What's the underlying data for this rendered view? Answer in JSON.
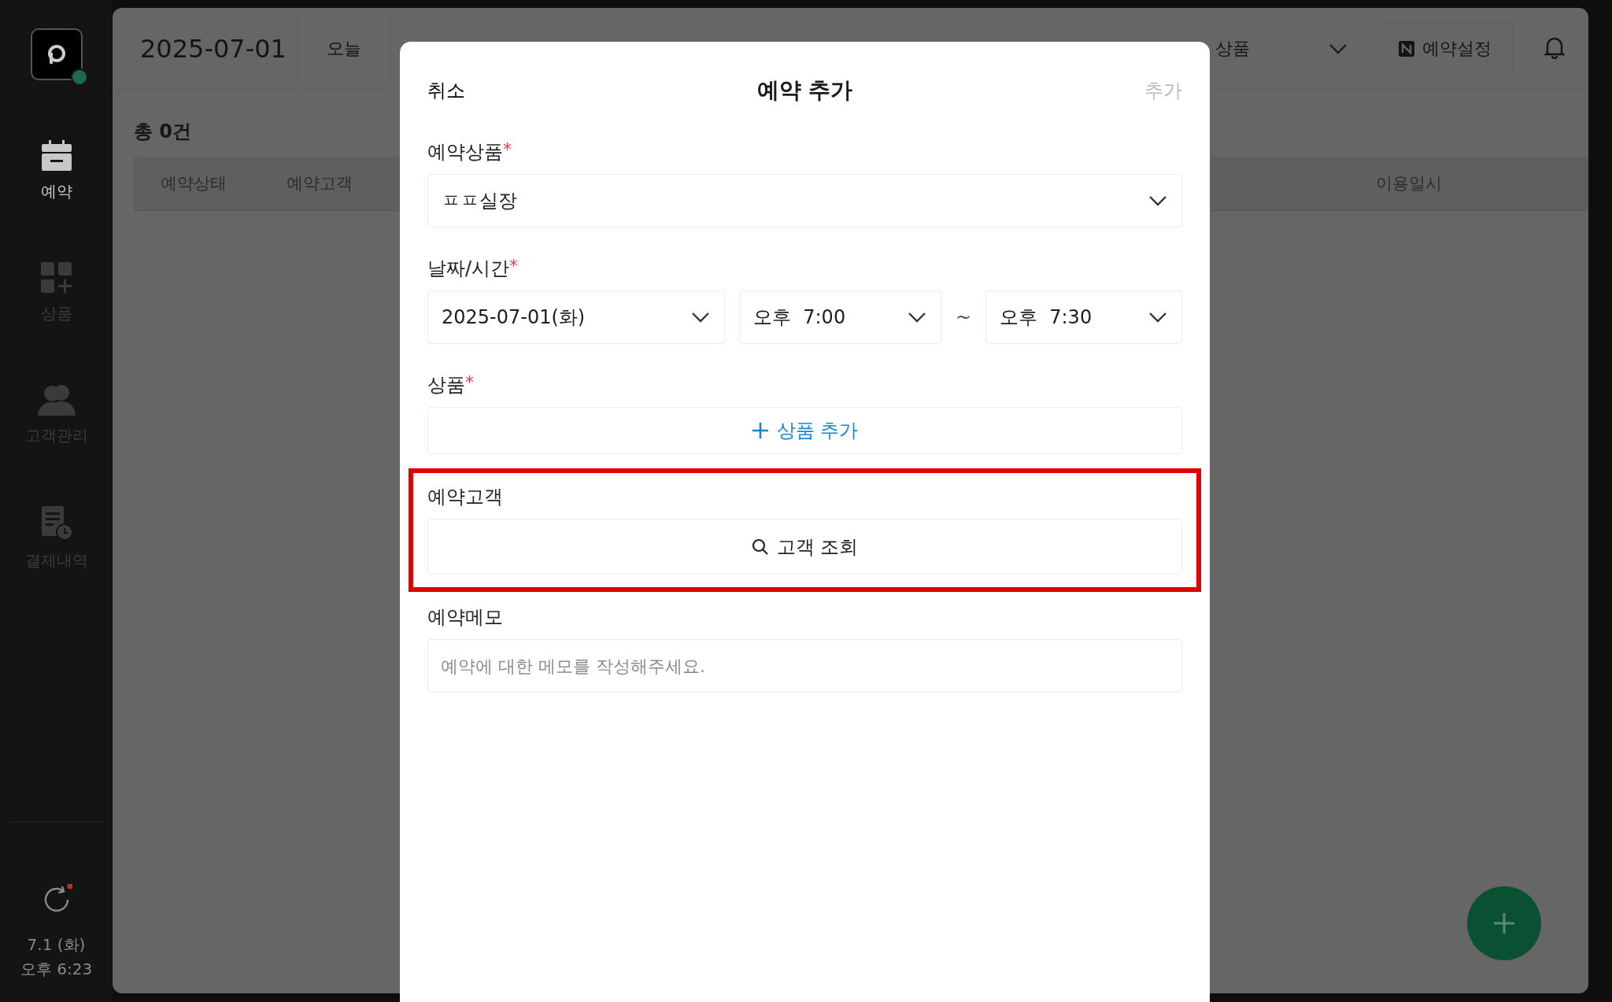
{
  "sidebar": {
    "items": [
      {
        "label": "예약",
        "kind": "calendar",
        "selected": true
      },
      {
        "label": "상품",
        "kind": "products",
        "selected": false
      },
      {
        "label": "고객관리",
        "kind": "customers",
        "selected": false
      },
      {
        "label": "결제내역",
        "kind": "payments",
        "selected": false
      }
    ],
    "date": "7.1 (화)",
    "time": "오후 6:23"
  },
  "header": {
    "date": "2025-07-01",
    "today_button": "오늘",
    "product_filter": "상품",
    "settings_button": "예약설정"
  },
  "summary": "총 0건",
  "table": {
    "columns": [
      "예약상태",
      "예약고객",
      "이용일시"
    ]
  },
  "modal": {
    "cancel": "취소",
    "title": "예약 추가",
    "confirm": {
      "label": "추가",
      "disabled": true
    },
    "product": {
      "label": "예약상품",
      "required_mark": "*",
      "value": "ㅍㅍ실장"
    },
    "datetime": {
      "label": "날짜/시간",
      "required_mark": "*",
      "date": "2025-07-01(화)",
      "start": "오후  7:00",
      "separator": "~",
      "end": "오후  7:30"
    },
    "items": {
      "label": "상품",
      "required_mark": "*",
      "add_button": "상품 추가"
    },
    "customer": {
      "label": "예약고객",
      "highlighted": true,
      "search_button": "고객 조회"
    },
    "memo": {
      "label": "예약메모",
      "placeholder": "예약에 대한 메모를 작성해주세요."
    }
  }
}
